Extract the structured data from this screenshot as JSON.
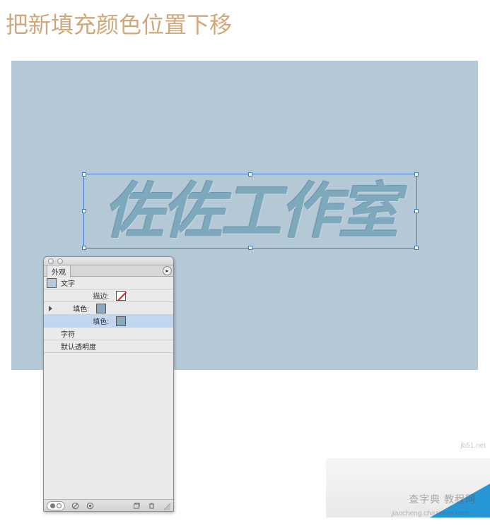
{
  "heading": "把新填充颜色位置下移",
  "artwork_text": "佐佐工作室",
  "panel": {
    "tab_label": "外观",
    "rows": {
      "object_type": "文字",
      "stroke_label": "描边:",
      "fill1_label": "填色:",
      "fill2_label": "填色:",
      "characters_label": "字符",
      "opacity_label": "默认透明度"
    }
  },
  "watermark_main": "查字典  教程网",
  "watermark_url_top": "jb51.net",
  "watermark_sub": "jiaocheng.chazidian.com"
}
